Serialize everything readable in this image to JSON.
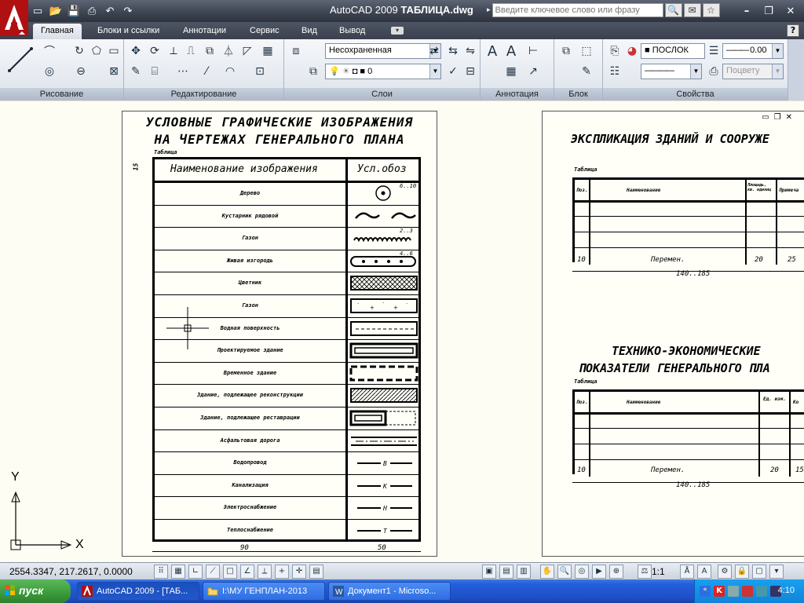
{
  "window": {
    "title_app": "AutoCAD 2009",
    "title_file": "ТАБЛИЦА.dwg",
    "search_placeholder": "Введите ключевое слово или фразу"
  },
  "ribbon": {
    "tabs": [
      "Главная",
      "Блоки и ссылки",
      "Аннотации",
      "Сервис",
      "Вид",
      "Вывод"
    ],
    "panels": {
      "draw": "Рисование",
      "modify": "Редактирование",
      "layers": "Слои",
      "annotation": "Аннотация",
      "block": "Блок",
      "properties": "Свойства"
    },
    "layer_state": "Несохраненная",
    "layer_current": "0",
    "color_value": "ПОСЛОК",
    "lineweight_value": "0.00",
    "plotstyle_value": "Поцвету"
  },
  "drawing": {
    "sheet1": {
      "title_line1": "УСЛОВНЫЕ ГРАФИЧЕСКИЕ ИЗОБРАЖЕНИЯ",
      "title_line2": "НА ЧЕРТЕЖАХ ГЕНЕРАЛЬНОГО ПЛАНА",
      "table_label": "Таблица",
      "col_name": "Наименование изображения",
      "col_symbol": "Усл.обоз",
      "header_height": "15",
      "width_name": "90",
      "width_symbol": "50",
      "rows": [
        "Дерево",
        "Кустарник рядовой",
        "Газон",
        "Живая изгородь",
        "Цветник",
        "Газон",
        "Водная поверхность",
        "Проектируемое здание",
        "Временное здание",
        "Здание, подлежащее реконструкции",
        "Здание, подлежащее реставрации",
        "Асфальтовая дорога",
        "Водопровод",
        "Канализация",
        "Электроснабжение",
        "Теплоснабжение"
      ],
      "dims": {
        "tree": "6..10",
        "wave": "2..3",
        "hedge": "4..6"
      },
      "line_letters": [
        "В",
        "К",
        "Н",
        "Т"
      ]
    },
    "sheet2": {
      "title1": "ЭКСПЛИКАЦИЯ ЗДАНИЙ И СООРУЖЕ",
      "table_label": "Таблица",
      "t1_cols": [
        "Поз.",
        "Наименование",
        "Площадь, кв. единиц",
        "Примеча"
      ],
      "t1_dims": [
        "10",
        "Перемен.",
        "20",
        "25"
      ],
      "t1_total": "140..185",
      "title2_line1": "ТЕХНИКО-ЭКОНОМИЧЕСКИЕ",
      "title2_line2": "ПОКАЗАТЕЛИ ГЕНЕРАЛЬНОГО ПЛА",
      "t2_cols": [
        "Поз.",
        "Наименование",
        "Ед. изм.",
        "Ко"
      ],
      "t2_dims": [
        "10",
        "Перемен.",
        "20",
        "15"
      ],
      "t2_total": "140..185"
    },
    "ucs": {
      "x": "X",
      "y": "Y"
    }
  },
  "status": {
    "coords": "2554.3347, 217.2617, 0.0000",
    "scale": "1:1"
  },
  "taskbar": {
    "start": "пуск",
    "tasks": [
      "AutoCAD 2009 - [ТАБ...",
      "I:\\МУ ГЕНПЛАН-2013",
      "Документ1 - Microso..."
    ],
    "clock": "4:10"
  },
  "colors": {
    "titlebar": "#3c4350",
    "taskbar": "#245edb",
    "drawing_bg": "#fdfdf3"
  }
}
